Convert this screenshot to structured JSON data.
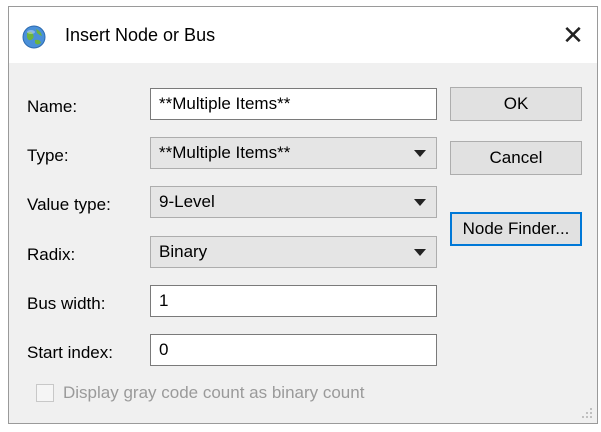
{
  "dialog": {
    "title": "Insert Node or Bus",
    "close_symbol": "✕",
    "icon": "globe-icon"
  },
  "form": {
    "name_label": "Name:",
    "name_value": "**Multiple Items**",
    "type_label": "Type:",
    "type_value": "**Multiple Items**",
    "value_type_label": "Value type:",
    "value_type_value": "9-Level",
    "radix_label": "Radix:",
    "radix_value": "Binary",
    "bus_width_label": "Bus width:",
    "bus_width_value": "1",
    "start_index_label": "Start index:",
    "start_index_value": "0",
    "gray_code_label": "Display gray code count as binary count"
  },
  "buttons": {
    "ok": "OK",
    "cancel": "Cancel",
    "node_finder": "Node Finder..."
  }
}
